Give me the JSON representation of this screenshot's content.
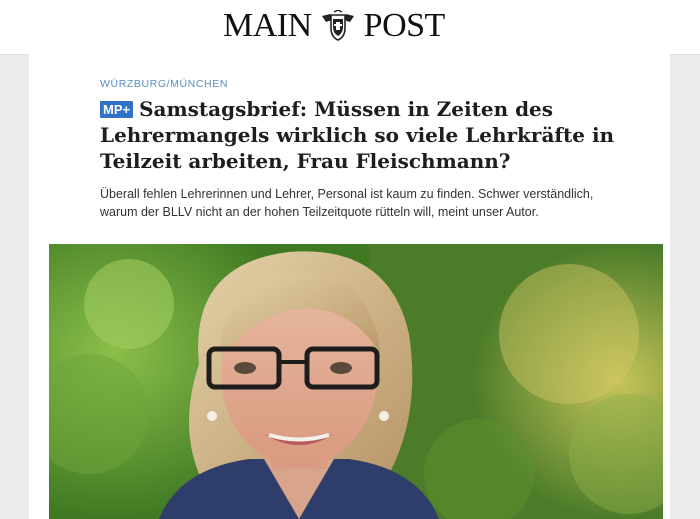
{
  "header": {
    "logo_left": "MAIN",
    "logo_right": "POST",
    "logo_crest_icon": "coat-of-arms-icon"
  },
  "article": {
    "kicker": "WÜRZBURG/MÜNCHEN",
    "badge": "MP+",
    "headline": "Samstagsbrief: Müssen in Zeiten des Lehrermangels wirklich so viele Lehrkräfte in Teilzeit arbeiten, Frau Fleischmann?",
    "lead": "Überall fehlen Lehrerinnen und Lehrer, Personal ist kaum zu finden. Schwer verständlich, warum der BLLV nicht an der hohen Teilzeitquote rütteln will, meint unser Autor."
  },
  "colors": {
    "accent": "#2f72c7",
    "kicker": "#5a8fc0",
    "background": "#ececec"
  }
}
